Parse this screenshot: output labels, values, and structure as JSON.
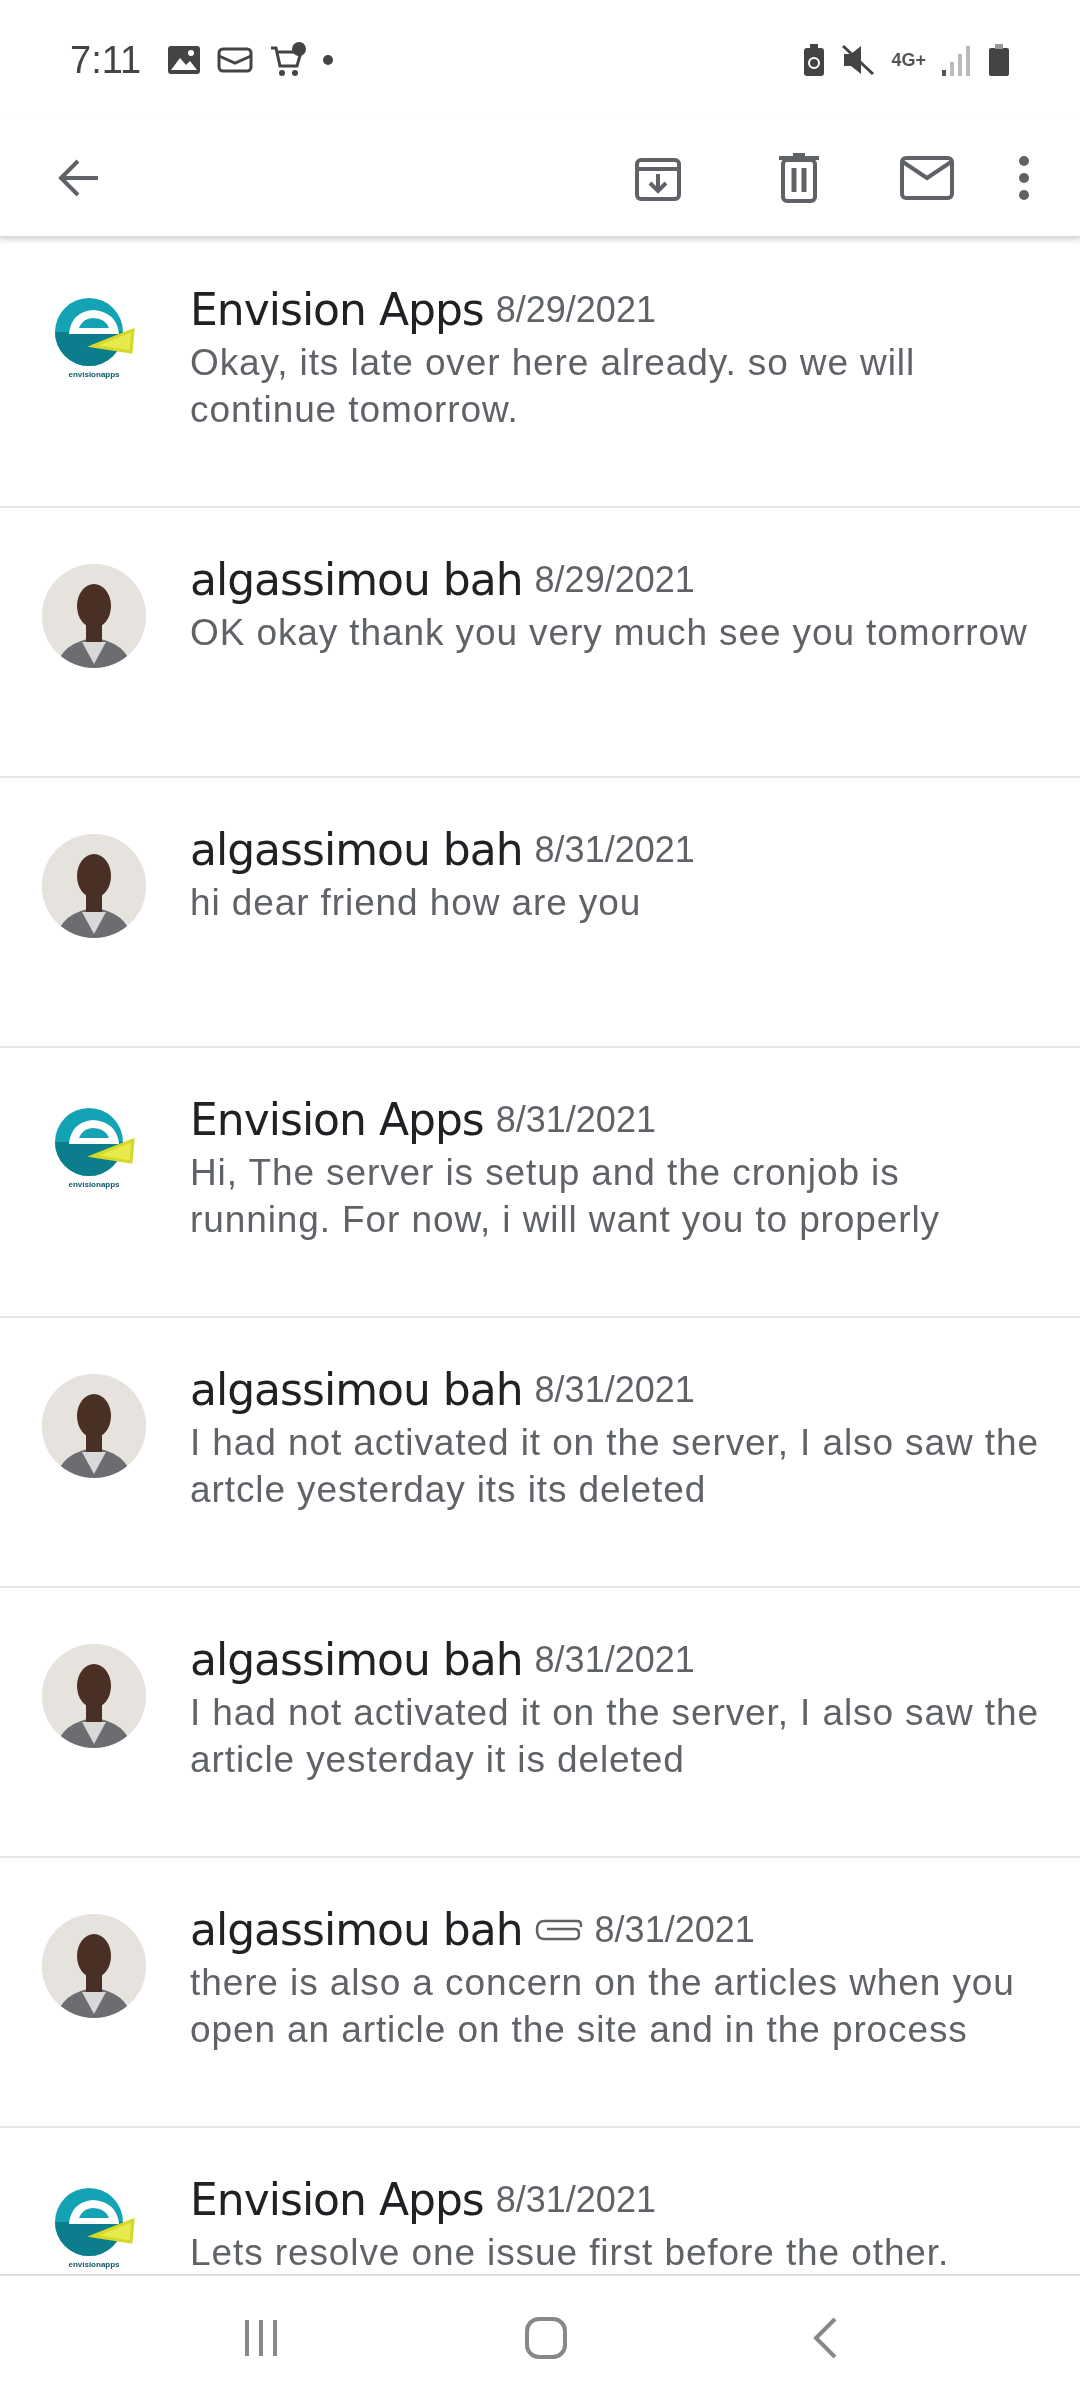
{
  "status_bar": {
    "time": "7:11",
    "network": "4G+"
  },
  "messages": [
    {
      "kind": "logo",
      "logo_text": "envisionapps",
      "sender": "Envision Apps",
      "attachment": false,
      "date": "8/29/2021",
      "snippet": "Okay, its late over here already. so we will continue tomorrow."
    },
    {
      "kind": "person",
      "sender": "algassimou bah",
      "attachment": false,
      "date": "8/29/2021",
      "snippet": "OK okay thank you very much see you tomorrow"
    },
    {
      "kind": "person",
      "sender": "algassimou bah",
      "attachment": false,
      "date": "8/31/2021",
      "snippet": "hi dear friend how are you"
    },
    {
      "kind": "logo",
      "logo_text": "envisionapps",
      "sender": "Envision Apps",
      "attachment": false,
      "date": "8/31/2021",
      "snippet": "Hi, The server is setup and the cronjob is running. For now, i will want you to properly"
    },
    {
      "kind": "person",
      "sender": "algassimou bah",
      "attachment": false,
      "date": "8/31/2021",
      "snippet": "I had not activated it on the server, I also saw the artcle yesterday its its deleted"
    },
    {
      "kind": "person",
      "sender": "algassimou bah",
      "attachment": false,
      "date": "8/31/2021",
      "snippet": "I had not activated it on the server, I also saw the article yesterday it is deleted"
    },
    {
      "kind": "person",
      "sender": "algassimou bah",
      "attachment": true,
      "date": "8/31/2021",
      "snippet": "there is also a concern on the articles when you open an article on the site and in the process"
    },
    {
      "kind": "logo",
      "logo_text": "envisionapps",
      "sender": "Envision Apps",
      "attachment": false,
      "date": "8/31/2021",
      "snippet": "Lets resolve one issue first before the other."
    }
  ]
}
